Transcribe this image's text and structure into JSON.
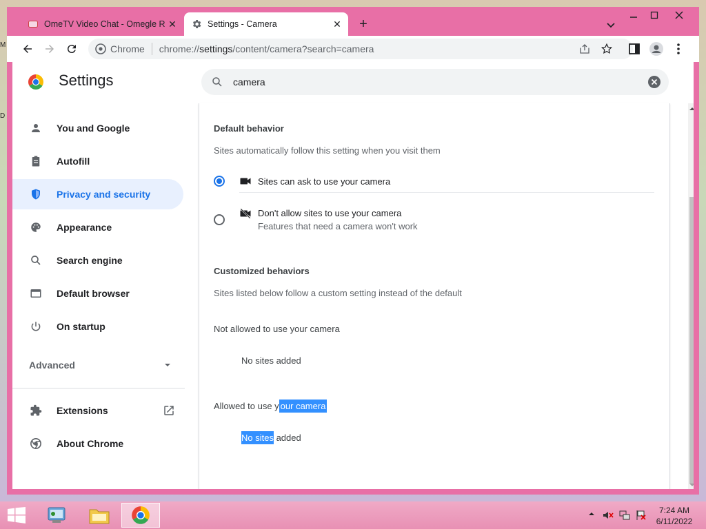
{
  "tabs": [
    {
      "title": "OmeTV Video Chat - Omegle Ra",
      "active": false
    },
    {
      "title": "Settings - Camera",
      "active": true
    }
  ],
  "new_tab": "+",
  "omnibox": {
    "site_label": "Chrome",
    "url_prefix": "chrome://",
    "url_host": "settings",
    "url_rest": "/content/camera?search=camera"
  },
  "settings": {
    "title": "Settings",
    "search_value": "camera",
    "nav": [
      {
        "label": "You and Google",
        "icon": "person-icon"
      },
      {
        "label": "Autofill",
        "icon": "clipboard-icon"
      },
      {
        "label": "Privacy and security",
        "icon": "shield-icon",
        "selected": true
      },
      {
        "label": "Appearance",
        "icon": "palette-icon"
      },
      {
        "label": "Search engine",
        "icon": "search-icon"
      },
      {
        "label": "Default browser",
        "icon": "browser-icon"
      },
      {
        "label": "On startup",
        "icon": "power-icon"
      }
    ],
    "advanced": "Advanced",
    "nav_bottom": [
      {
        "label": "Extensions",
        "icon": "puzzle-icon"
      },
      {
        "label": "About Chrome",
        "icon": "chrome-icon"
      }
    ]
  },
  "camera": {
    "default_title": "Default behavior",
    "default_sub": "Sites automatically follow this setting when you visit them",
    "option_allow": "Sites can ask to use your camera",
    "option_block": "Don't allow sites to use your camera",
    "option_block_sub": "Features that need a camera won't work",
    "custom_title": "Customized behaviors",
    "custom_sub": "Sites listed below follow a custom setting instead of the default",
    "not_allowed_title": "Not allowed to use your camera",
    "not_allowed_empty": "No sites added",
    "allowed_title_a": "Allowed to use y",
    "allowed_title_b": "our camera",
    "allowed_empty_a": "No sites",
    "allowed_empty_b": " added"
  },
  "taskbar": {
    "time": "7:24 AM",
    "date": "6/11/2022"
  },
  "colors": {
    "accent": "#1a73e8",
    "frame": "#e86fa6",
    "selection": "#3390ff"
  }
}
